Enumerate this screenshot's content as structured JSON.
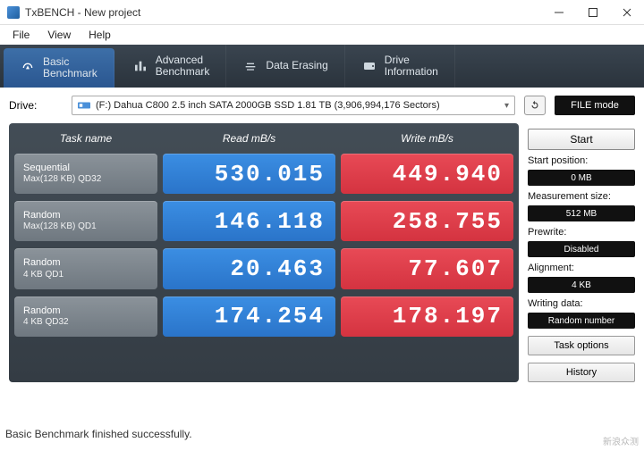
{
  "window": {
    "title": "TxBENCH - New project"
  },
  "menu": {
    "file": "File",
    "view": "View",
    "help": "Help"
  },
  "tabs": {
    "basic": "Basic\nBenchmark",
    "advanced": "Advanced\nBenchmark",
    "erase": "Data Erasing",
    "drive": "Drive\nInformation"
  },
  "drivebar": {
    "label": "Drive:",
    "selected": "(F:) Dahua C800 2.5 inch SATA 2000GB SSD  1.81 TB (3,906,994,176 Sectors)",
    "filemode": "FILE mode"
  },
  "headers": {
    "task": "Task name",
    "read": "Read mB/s",
    "write": "Write mB/s"
  },
  "tasks": [
    {
      "name": "Sequential",
      "sub": "Max(128 KB) QD32",
      "read": "530.015",
      "write": "449.940"
    },
    {
      "name": "Random",
      "sub": "Max(128 KB) QD1",
      "read": "146.118",
      "write": "258.755"
    },
    {
      "name": "Random",
      "sub": "4 KB QD1",
      "read": "20.463",
      "write": "77.607"
    },
    {
      "name": "Random",
      "sub": "4 KB QD32",
      "read": "174.254",
      "write": "178.197"
    }
  ],
  "side": {
    "start": "Start",
    "startpos_label": "Start position:",
    "startpos_value": "0 MB",
    "msize_label": "Measurement size:",
    "msize_value": "512 MB",
    "prewrite_label": "Prewrite:",
    "prewrite_value": "Disabled",
    "align_label": "Alignment:",
    "align_value": "4 KB",
    "wdata_label": "Writing data:",
    "wdata_value": "Random number",
    "task_options": "Task options",
    "history": "History"
  },
  "status": "Basic Benchmark finished successfully.",
  "watermark": "新浪众测"
}
